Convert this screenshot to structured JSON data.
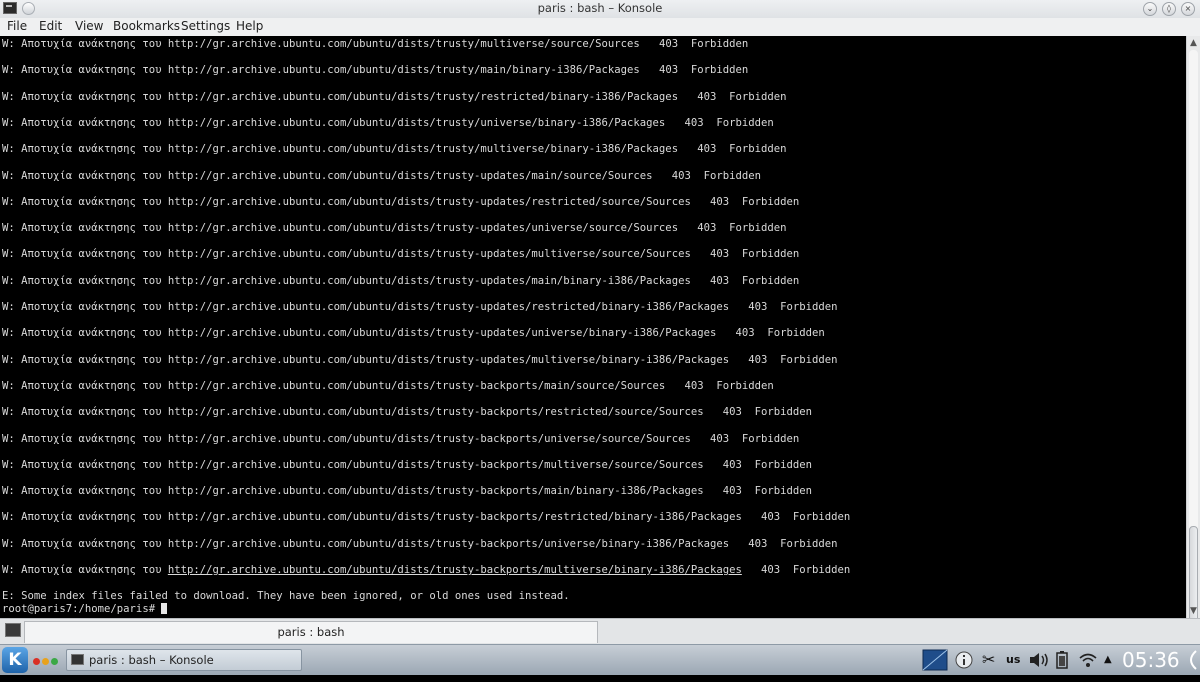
{
  "window": {
    "title": "paris : bash – Konsole"
  },
  "menu": [
    "File",
    "Edit",
    "View",
    "Bookmarks",
    "Settings",
    "Help"
  ],
  "terminal": {
    "lines": [
      {
        "prefix": "W: Αποτυχία ανάκτησης του ",
        "url": "http://gr.archive.ubuntu.com/ubuntu/dists/trusty/multiverse/source/Sources",
        "status": "   403  Forbidden"
      },
      {
        "prefix": "W: Αποτυχία ανάκτησης του ",
        "url": "http://gr.archive.ubuntu.com/ubuntu/dists/trusty/main/binary-i386/Packages",
        "status": "   403  Forbidden"
      },
      {
        "prefix": "W: Αποτυχία ανάκτησης του ",
        "url": "http://gr.archive.ubuntu.com/ubuntu/dists/trusty/restricted/binary-i386/Packages",
        "status": "   403  Forbidden"
      },
      {
        "prefix": "W: Αποτυχία ανάκτησης του ",
        "url": "http://gr.archive.ubuntu.com/ubuntu/dists/trusty/universe/binary-i386/Packages",
        "status": "   403  Forbidden"
      },
      {
        "prefix": "W: Αποτυχία ανάκτησης του ",
        "url": "http://gr.archive.ubuntu.com/ubuntu/dists/trusty/multiverse/binary-i386/Packages",
        "status": "   403  Forbidden"
      },
      {
        "prefix": "W: Αποτυχία ανάκτησης του ",
        "url": "http://gr.archive.ubuntu.com/ubuntu/dists/trusty-updates/main/source/Sources",
        "status": "   403  Forbidden"
      },
      {
        "prefix": "W: Αποτυχία ανάκτησης του ",
        "url": "http://gr.archive.ubuntu.com/ubuntu/dists/trusty-updates/restricted/source/Sources",
        "status": "   403  Forbidden"
      },
      {
        "prefix": "W: Αποτυχία ανάκτησης του ",
        "url": "http://gr.archive.ubuntu.com/ubuntu/dists/trusty-updates/universe/source/Sources",
        "status": "   403  Forbidden"
      },
      {
        "prefix": "W: Αποτυχία ανάκτησης του ",
        "url": "http://gr.archive.ubuntu.com/ubuntu/dists/trusty-updates/multiverse/source/Sources",
        "status": "   403  Forbidden"
      },
      {
        "prefix": "W: Αποτυχία ανάκτησης του ",
        "url": "http://gr.archive.ubuntu.com/ubuntu/dists/trusty-updates/main/binary-i386/Packages",
        "status": "   403  Forbidden"
      },
      {
        "prefix": "W: Αποτυχία ανάκτησης του ",
        "url": "http://gr.archive.ubuntu.com/ubuntu/dists/trusty-updates/restricted/binary-i386/Packages",
        "status": "   403  Forbidden"
      },
      {
        "prefix": "W: Αποτυχία ανάκτησης του ",
        "url": "http://gr.archive.ubuntu.com/ubuntu/dists/trusty-updates/universe/binary-i386/Packages",
        "status": "   403  Forbidden"
      },
      {
        "prefix": "W: Αποτυχία ανάκτησης του ",
        "url": "http://gr.archive.ubuntu.com/ubuntu/dists/trusty-updates/multiverse/binary-i386/Packages",
        "status": "   403  Forbidden"
      },
      {
        "prefix": "W: Αποτυχία ανάκτησης του ",
        "url": "http://gr.archive.ubuntu.com/ubuntu/dists/trusty-backports/main/source/Sources",
        "status": "   403  Forbidden"
      },
      {
        "prefix": "W: Αποτυχία ανάκτησης του ",
        "url": "http://gr.archive.ubuntu.com/ubuntu/dists/trusty-backports/restricted/source/Sources",
        "status": "   403  Forbidden"
      },
      {
        "prefix": "W: Αποτυχία ανάκτησης του ",
        "url": "http://gr.archive.ubuntu.com/ubuntu/dists/trusty-backports/universe/source/Sources",
        "status": "   403  Forbidden"
      },
      {
        "prefix": "W: Αποτυχία ανάκτησης του ",
        "url": "http://gr.archive.ubuntu.com/ubuntu/dists/trusty-backports/multiverse/source/Sources",
        "status": "   403  Forbidden"
      },
      {
        "prefix": "W: Αποτυχία ανάκτησης του ",
        "url": "http://gr.archive.ubuntu.com/ubuntu/dists/trusty-backports/main/binary-i386/Packages",
        "status": "   403  Forbidden"
      },
      {
        "prefix": "W: Αποτυχία ανάκτησης του ",
        "url": "http://gr.archive.ubuntu.com/ubuntu/dists/trusty-backports/restricted/binary-i386/Packages",
        "status": "   403  Forbidden"
      },
      {
        "prefix": "W: Αποτυχία ανάκτησης του ",
        "url": "http://gr.archive.ubuntu.com/ubuntu/dists/trusty-backports/universe/binary-i386/Packages",
        "status": "   403  Forbidden"
      },
      {
        "prefix": "W: Αποτυχία ανάκτησης του ",
        "url": "http://gr.archive.ubuntu.com/ubuntu/dists/trusty-backports/multiverse/binary-i386/Packages",
        "status": "   403  Forbidden"
      }
    ],
    "error_line": "E: Some index files failed to download. They have been ignored, or old ones used instead.",
    "prompt": "root@paris7:/home/paris# "
  },
  "tabs": [
    {
      "label": "paris : bash"
    }
  ],
  "taskbar": {
    "task_label": "paris : bash – Konsole",
    "keyboard_layout": "us",
    "clock": "05:36"
  }
}
